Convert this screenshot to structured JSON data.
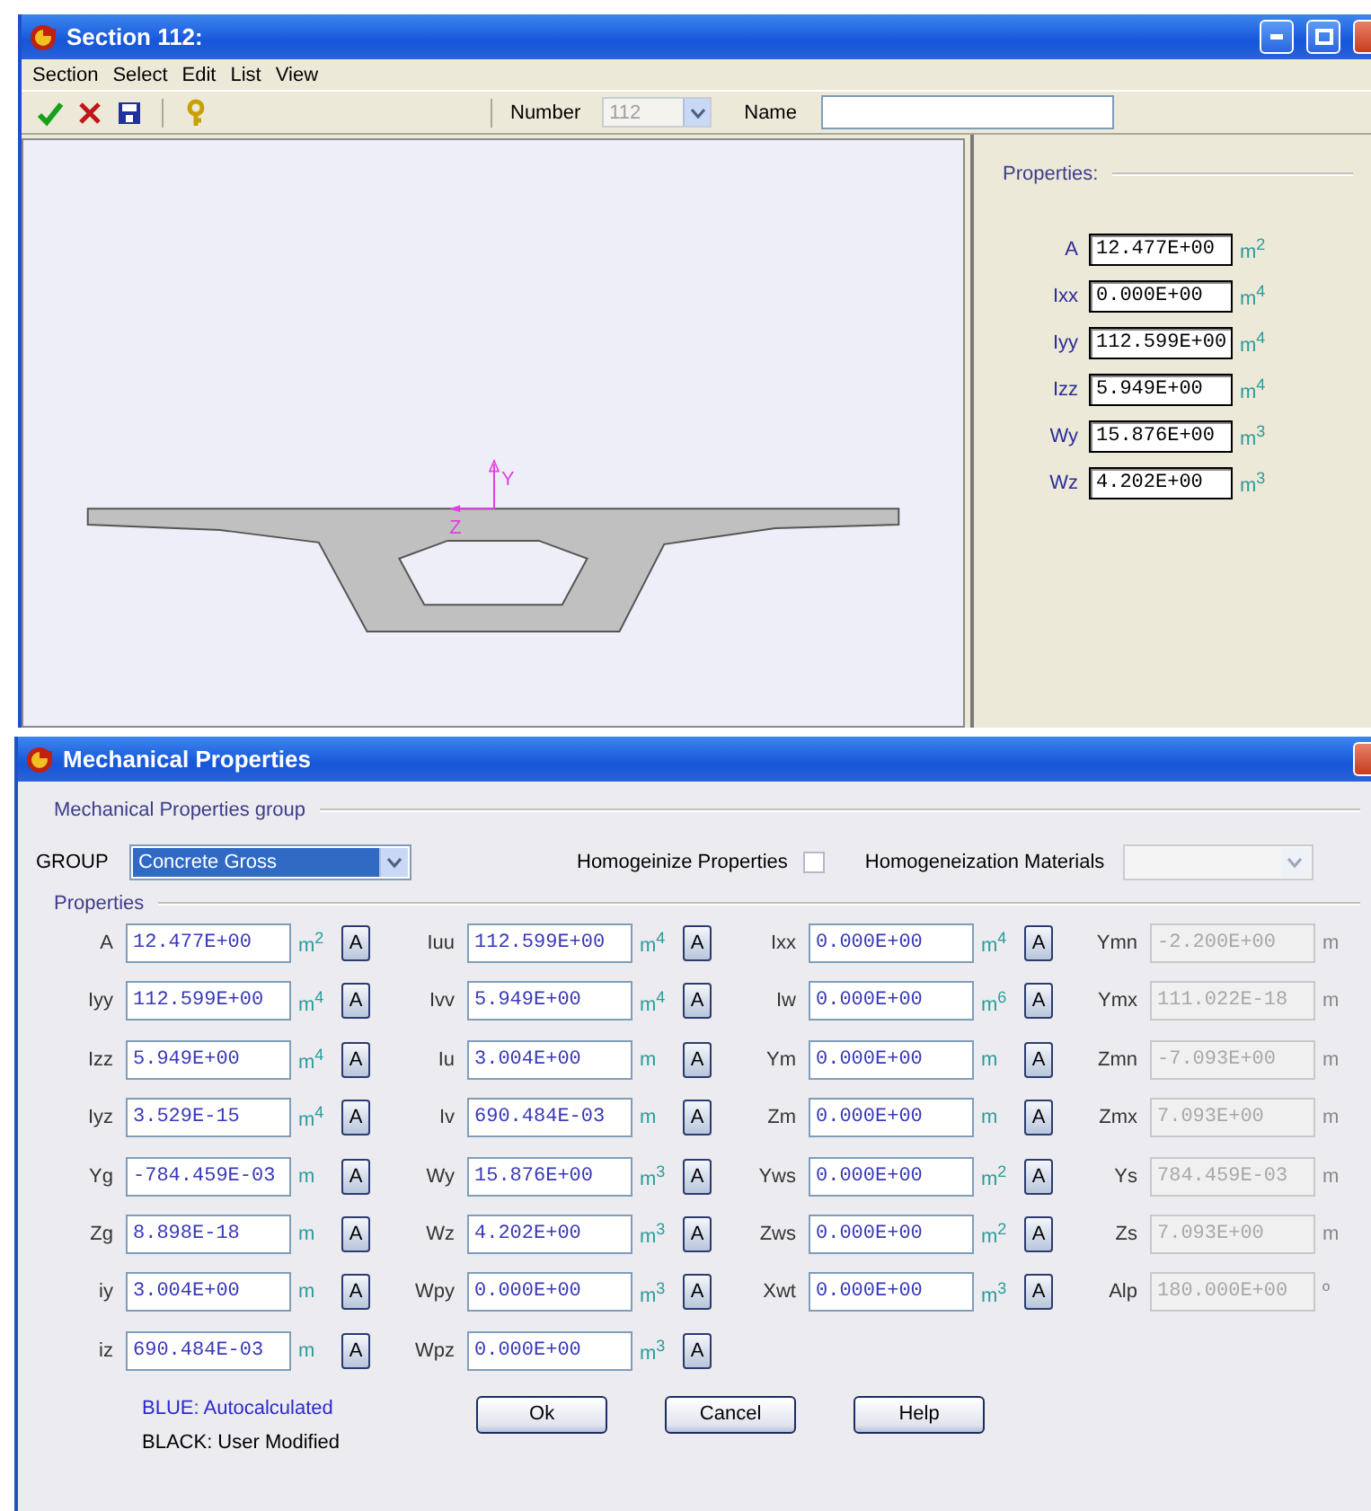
{
  "section_window": {
    "title": "Section 112:",
    "menu": [
      "Section",
      "Select",
      "Edit",
      "List",
      "View"
    ],
    "toolbar": {
      "number_label": "Number",
      "number_value": "112",
      "number_disabled": true,
      "name_label": "Name"
    },
    "section_view": {
      "y_axis_label": "Y",
      "z_axis_label": "Z"
    },
    "properties": {
      "title": "Properties:",
      "rows": [
        {
          "label": "A",
          "value": "12.477E+00",
          "unit": "m$^{2}$"
        },
        {
          "label": "Ixx",
          "value": "0.000E+00",
          "unit": "m$^{4}$"
        },
        {
          "label": "Iyy",
          "value": "112.599E+00",
          "unit": "m$^{4}$"
        },
        {
          "label": "Izz",
          "value": "5.949E+00",
          "unit": "m$^{4}$"
        },
        {
          "label": "Wy",
          "value": "15.876E+00",
          "unit": "m$^{3}$"
        },
        {
          "label": "Wz",
          "value": "4.202E+00",
          "unit": "m$^{3}$"
        }
      ]
    }
  },
  "dialog": {
    "title": "Mechanical Properties",
    "group_section": "Mechanical Properties group",
    "group_label": "GROUP",
    "group_value": "Concrete Gross",
    "homogenize_label": "Homogeinize Properties",
    "homogenize_checked": false,
    "materials_label": "Homogeneization Materials",
    "materials_disabled": true,
    "properties_section": "Properties",
    "columns": [
      {
        "fields": [
          {
            "label": "A",
            "value": "12.477E+00",
            "unit": "m$^{2}$",
            "kind": "auto",
            "button": "A"
          },
          {
            "label": "Iyy",
            "value": "112.599E+00",
            "unit": "m$^{4}$",
            "kind": "auto",
            "button": "A"
          },
          {
            "label": "Izz",
            "value": "5.949E+00",
            "unit": "m$^{4}$",
            "kind": "auto",
            "button": "A"
          },
          {
            "label": "Iyz",
            "value": "3.529E-15",
            "unit": "m$^{4}$",
            "kind": "auto",
            "button": "A"
          },
          {
            "label": "Yg",
            "value": "-784.459E-03",
            "unit": "m",
            "kind": "auto",
            "button": "A"
          },
          {
            "label": "Zg",
            "value": "8.898E-18",
            "unit": "m",
            "kind": "auto",
            "button": "A"
          },
          {
            "label": "iy",
            "value": "3.004E+00",
            "unit": "m",
            "kind": "auto",
            "button": "A"
          },
          {
            "label": "iz",
            "value": "690.484E-03",
            "unit": "m",
            "kind": "auto",
            "button": "A"
          }
        ]
      },
      {
        "fields": [
          {
            "label": "Iuu",
            "value": "112.599E+00",
            "unit": "m$^{4}$",
            "kind": "auto",
            "button": "A"
          },
          {
            "label": "Ivv",
            "value": "5.949E+00",
            "unit": "m$^{4}$",
            "kind": "auto",
            "button": "A"
          },
          {
            "label": "Iu",
            "value": "3.004E+00",
            "unit": "m",
            "kind": "auto",
            "button": "A"
          },
          {
            "label": "Iv",
            "value": "690.484E-03",
            "unit": "m",
            "kind": "auto",
            "button": "A"
          },
          {
            "label": "Wy",
            "value": "15.876E+00",
            "unit": "m$^{3}$",
            "kind": "auto",
            "button": "A"
          },
          {
            "label": "Wz",
            "value": "4.202E+00",
            "unit": "m$^{3}$",
            "kind": "auto",
            "button": "A"
          },
          {
            "label": "Wpy",
            "value": "0.000E+00",
            "unit": "m$^{3}$",
            "kind": "auto",
            "button": "A"
          },
          {
            "label": "Wpz",
            "value": "0.000E+00",
            "unit": "m$^{3}$",
            "kind": "auto",
            "button": "A"
          }
        ]
      },
      {
        "fields": [
          {
            "label": "Ixx",
            "value": "0.000E+00",
            "unit": "m$^{4}$",
            "kind": "auto",
            "button": "A"
          },
          {
            "label": "Iw",
            "value": "0.000E+00",
            "unit": "m$^{6}$",
            "kind": "auto",
            "button": "A"
          },
          {
            "label": "Ym",
            "value": "0.000E+00",
            "unit": "m",
            "kind": "auto",
            "button": "A"
          },
          {
            "label": "Zm",
            "value": "0.000E+00",
            "unit": "m",
            "kind": "auto",
            "button": "A"
          },
          {
            "label": "Yws",
            "value": "0.000E+00",
            "unit": "m$^{2}$",
            "kind": "auto",
            "button": "A"
          },
          {
            "label": "Zws",
            "value": "0.000E+00",
            "unit": "m$^{2}$",
            "kind": "auto",
            "button": "A"
          },
          {
            "label": "Xwt",
            "value": "0.000E+00",
            "unit": "m$^{3}$",
            "kind": "auto",
            "button": "A"
          }
        ]
      },
      {
        "fields": [
          {
            "label": "Ymn",
            "value": "-2.200E+00",
            "unit": "m",
            "kind": "readonly"
          },
          {
            "label": "Ymx",
            "value": "111.022E-18",
            "unit": "m",
            "kind": "readonly"
          },
          {
            "label": "Zmn",
            "value": "-7.093E+00",
            "unit": "m",
            "kind": "readonly"
          },
          {
            "label": "Zmx",
            "value": "7.093E+00",
            "unit": "m",
            "kind": "readonly"
          },
          {
            "label": "Ys",
            "value": "784.459E-03",
            "unit": "m",
            "kind": "readonly"
          },
          {
            "label": "Zs",
            "value": "7.093E+00",
            "unit": "m",
            "kind": "readonly"
          },
          {
            "label": "Alp",
            "value": "180.000E+00",
            "unit": "º",
            "kind": "readonly"
          }
        ]
      }
    ],
    "legend": [
      "BLUE: Autocalculated",
      "BLACK: User Modified"
    ],
    "buttons": [
      "Ok",
      "Cancel",
      "Help"
    ]
  }
}
